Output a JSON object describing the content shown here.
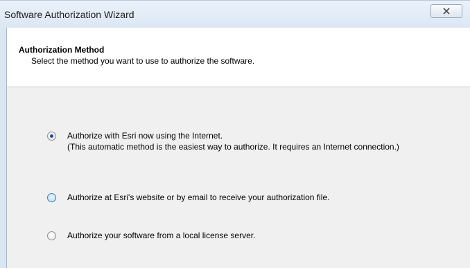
{
  "window": {
    "title": "Software Authorization Wizard"
  },
  "header": {
    "title": "Authorization Method",
    "subtitle": "Select the method you want to use to authorize the software."
  },
  "options": [
    {
      "label": "Authorize with Esri now using the Internet.",
      "sublabel": "(This automatic method is the easiest way to authorize. It requires an Internet connection.)",
      "checked": true
    },
    {
      "label": "Authorize at Esri's website or by email to receive your authorization file.",
      "checked": false
    },
    {
      "label": "Authorize your software from a local license server.",
      "checked": false
    }
  ],
  "icons": {
    "close": "close-icon"
  },
  "colors": {
    "titlebar": "#dce7f4",
    "header_bg": "#ffffff",
    "client_bg": "#f0f0f0",
    "radio_dot": "#1e4fa0"
  }
}
